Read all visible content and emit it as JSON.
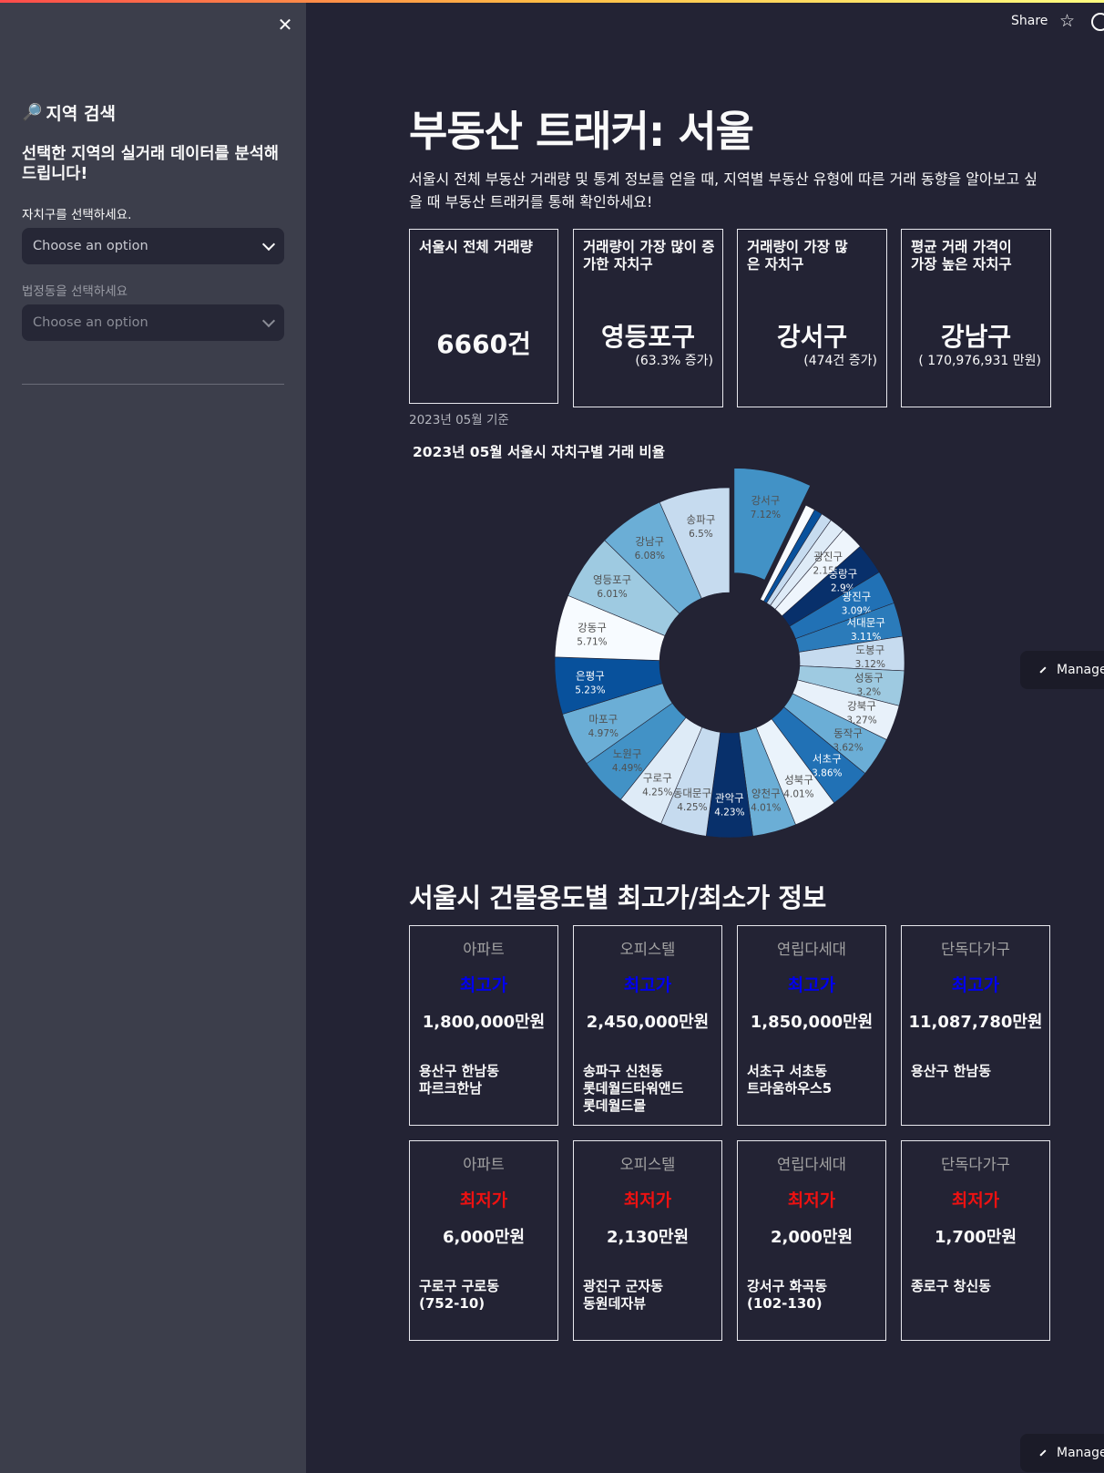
{
  "header": {
    "share_label": "Share"
  },
  "sidebar": {
    "heading": "지역 검색",
    "subheading": "선택한 지역의 실거래 데이터를 분석해드립니다!",
    "district_label": "자치구를 선택하세요.",
    "district_value": "Choose an option",
    "dong_label": "법정동을 선택하세요",
    "dong_value": "Choose an option"
  },
  "main": {
    "title": "부동산 트래커: 서울",
    "intro": "서울시 전체 부동산 거래량 및 통계 정보를 얻을 때, 지역별 부동산 유형에 따른 거래 동향을 알아보고 싶을 때 부동산 트래커를 통해 확인하세요!",
    "stats": [
      {
        "label": "서울시 전체 거래량",
        "value": "6660건",
        "sub": ""
      },
      {
        "label": "거래량이 가장 많이 증가한 자치구",
        "value": "영등포구",
        "sub": "(63.3% 증가)"
      },
      {
        "label": "거래량이 가장 많은 자치구",
        "value": "강서구",
        "sub": "(474건 증가)"
      },
      {
        "label": "평균 거래 가격이 가장 높은 자치구",
        "value": "강남구",
        "sub": "( 170,976,931 만원)"
      }
    ],
    "basis": "2023년 05월 기준",
    "chart_title": "2023년 05월 서울시 자치구별 거래 비율",
    "section_title": "서울시 건물용도별 최고가/최소가 정보",
    "max_cards": [
      {
        "type": "아파트",
        "kind": "최고가",
        "price": "1,800,000만원",
        "loc": "용산구 한남동\n파르크한남"
      },
      {
        "type": "오피스텔",
        "kind": "최고가",
        "price": "2,450,000만원",
        "loc": "송파구 신천동\n롯데월드타워앤드\n롯데월드몰"
      },
      {
        "type": "연립다세대",
        "kind": "최고가",
        "price": "1,850,000만원",
        "loc": "서초구 서초동\n트라움하우스5"
      },
      {
        "type": "단독다가구",
        "kind": "최고가",
        "price": "11,087,780만원",
        "loc": "용산구 한남동"
      }
    ],
    "min_cards": [
      {
        "type": "아파트",
        "kind": "최저가",
        "price": "6,000만원",
        "loc": "구로구 구로동\n(752-10)"
      },
      {
        "type": "오피스텔",
        "kind": "최저가",
        "price": "2,130만원",
        "loc": "광진구 군자동\n동원데자뷰"
      },
      {
        "type": "연립다세대",
        "kind": "최저가",
        "price": "2,000만원",
        "loc": "강서구 화곡동\n(102-130)"
      },
      {
        "type": "단독다가구",
        "kind": "최저가",
        "price": "1,700만원",
        "loc": "종로구 창신동"
      }
    ],
    "manage_label": "Manage app"
  },
  "chart_data": {
    "type": "pie",
    "title": "2023년 05월 서울시 자치구별 거래 비율",
    "donut": true,
    "slices": [
      {
        "label": "강서구",
        "value": 7.12,
        "color": "#4292c6",
        "pulled": true
      },
      {
        "label": "",
        "value": 0.9,
        "color": "#f7fbff"
      },
      {
        "label": "",
        "value": 0.75,
        "color": "#08519c"
      },
      {
        "label": "",
        "value": 1.0,
        "color": "#c6dbef"
      },
      {
        "label": "",
        "value": 1.4,
        "color": "#deebf7"
      },
      {
        "label": "광진구",
        "value": 2.15,
        "color": "#eef5fc"
      },
      {
        "label": "중랑구",
        "value": 2.9,
        "color": "#08306b"
      },
      {
        "label": "광진구",
        "value": 3.09,
        "color": "#2171b5"
      },
      {
        "label": "서대문구",
        "value": 3.11,
        "color": "#2b7bba"
      },
      {
        "label": "도봉구",
        "value": 3.12,
        "color": "#c6dbef"
      },
      {
        "label": "성동구",
        "value": 3.2,
        "color": "#9ecae1"
      },
      {
        "label": "강북구",
        "value": 3.27,
        "color": "#e8f1fa"
      },
      {
        "label": "동작구",
        "value": 3.62,
        "color": "#6baed6"
      },
      {
        "label": "서초구",
        "value": 3.86,
        "color": "#2171b5"
      },
      {
        "label": "성북구",
        "value": 4.01,
        "color": "#eaf3fb"
      },
      {
        "label": "양천구",
        "value": 4.01,
        "color": "#6baed6"
      },
      {
        "label": "관악구",
        "value": 4.23,
        "color": "#08306b"
      },
      {
        "label": "동대문구",
        "value": 4.25,
        "color": "#c6dbef"
      },
      {
        "label": "구로구",
        "value": 4.25,
        "color": "#deebf7"
      },
      {
        "label": "노원구",
        "value": 4.49,
        "color": "#4292c6"
      },
      {
        "label": "마포구",
        "value": 4.97,
        "color": "#6baed6"
      },
      {
        "label": "은평구",
        "value": 5.23,
        "color": "#08519c"
      },
      {
        "label": "강동구",
        "value": 5.71,
        "color": "#f7fbff"
      },
      {
        "label": "영등포구",
        "value": 6.01,
        "color": "#9ecae1"
      },
      {
        "label": "강남구",
        "value": 6.08,
        "color": "#6baed6"
      },
      {
        "label": "송파구",
        "value": 6.5,
        "color": "#c6dbef"
      }
    ]
  }
}
